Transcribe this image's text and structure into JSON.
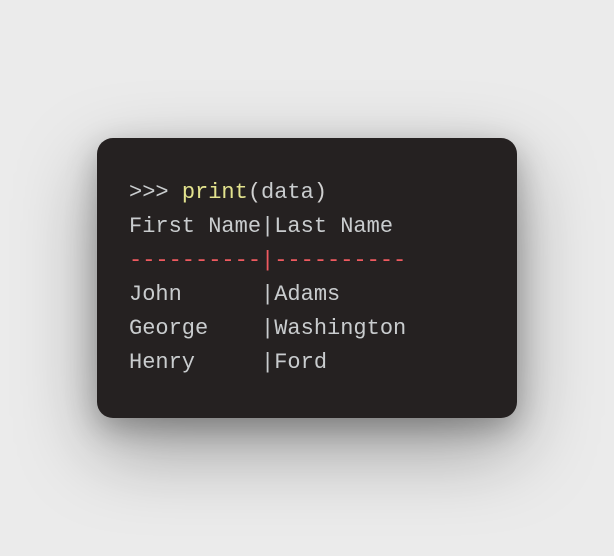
{
  "console": {
    "prompt": ">>> ",
    "func": "print",
    "open_paren": "(",
    "arg": "data",
    "close_paren": ")",
    "header_line": "First Name|Last Name",
    "separator_line": "----------|----------",
    "rows": [
      "John      |Adams",
      "George    |Washington",
      "Henry     |Ford"
    ]
  }
}
